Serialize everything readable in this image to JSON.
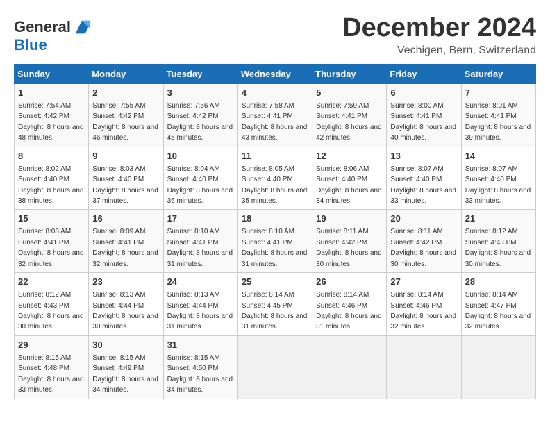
{
  "header": {
    "logo_line1": "General",
    "logo_line2": "Blue",
    "month": "December 2024",
    "location": "Vechigen, Bern, Switzerland"
  },
  "weekdays": [
    "Sunday",
    "Monday",
    "Tuesday",
    "Wednesday",
    "Thursday",
    "Friday",
    "Saturday"
  ],
  "weeks": [
    [
      {
        "day": "1",
        "info": "Sunrise: 7:54 AM\nSunset: 4:42 PM\nDaylight: 8 hours and 48 minutes."
      },
      {
        "day": "2",
        "info": "Sunrise: 7:55 AM\nSunset: 4:42 PM\nDaylight: 8 hours and 46 minutes."
      },
      {
        "day": "3",
        "info": "Sunrise: 7:56 AM\nSunset: 4:42 PM\nDaylight: 8 hours and 45 minutes."
      },
      {
        "day": "4",
        "info": "Sunrise: 7:58 AM\nSunset: 4:41 PM\nDaylight: 8 hours and 43 minutes."
      },
      {
        "day": "5",
        "info": "Sunrise: 7:59 AM\nSunset: 4:41 PM\nDaylight: 8 hours and 42 minutes."
      },
      {
        "day": "6",
        "info": "Sunrise: 8:00 AM\nSunset: 4:41 PM\nDaylight: 8 hours and 40 minutes."
      },
      {
        "day": "7",
        "info": "Sunrise: 8:01 AM\nSunset: 4:41 PM\nDaylight: 8 hours and 39 minutes."
      }
    ],
    [
      {
        "day": "8",
        "info": "Sunrise: 8:02 AM\nSunset: 4:40 PM\nDaylight: 8 hours and 38 minutes."
      },
      {
        "day": "9",
        "info": "Sunrise: 8:03 AM\nSunset: 4:40 PM\nDaylight: 8 hours and 37 minutes."
      },
      {
        "day": "10",
        "info": "Sunrise: 8:04 AM\nSunset: 4:40 PM\nDaylight: 8 hours and 36 minutes."
      },
      {
        "day": "11",
        "info": "Sunrise: 8:05 AM\nSunset: 4:40 PM\nDaylight: 8 hours and 35 minutes."
      },
      {
        "day": "12",
        "info": "Sunrise: 8:06 AM\nSunset: 4:40 PM\nDaylight: 8 hours and 34 minutes."
      },
      {
        "day": "13",
        "info": "Sunrise: 8:07 AM\nSunset: 4:40 PM\nDaylight: 8 hours and 33 minutes."
      },
      {
        "day": "14",
        "info": "Sunrise: 8:07 AM\nSunset: 4:40 PM\nDaylight: 8 hours and 33 minutes."
      }
    ],
    [
      {
        "day": "15",
        "info": "Sunrise: 8:08 AM\nSunset: 4:41 PM\nDaylight: 8 hours and 32 minutes."
      },
      {
        "day": "16",
        "info": "Sunrise: 8:09 AM\nSunset: 4:41 PM\nDaylight: 8 hours and 32 minutes."
      },
      {
        "day": "17",
        "info": "Sunrise: 8:10 AM\nSunset: 4:41 PM\nDaylight: 8 hours and 31 minutes."
      },
      {
        "day": "18",
        "info": "Sunrise: 8:10 AM\nSunset: 4:41 PM\nDaylight: 8 hours and 31 minutes."
      },
      {
        "day": "19",
        "info": "Sunrise: 8:11 AM\nSunset: 4:42 PM\nDaylight: 8 hours and 30 minutes."
      },
      {
        "day": "20",
        "info": "Sunrise: 8:11 AM\nSunset: 4:42 PM\nDaylight: 8 hours and 30 minutes."
      },
      {
        "day": "21",
        "info": "Sunrise: 8:12 AM\nSunset: 4:43 PM\nDaylight: 8 hours and 30 minutes."
      }
    ],
    [
      {
        "day": "22",
        "info": "Sunrise: 8:12 AM\nSunset: 4:43 PM\nDaylight: 8 hours and 30 minutes."
      },
      {
        "day": "23",
        "info": "Sunrise: 8:13 AM\nSunset: 4:44 PM\nDaylight: 8 hours and 30 minutes."
      },
      {
        "day": "24",
        "info": "Sunrise: 8:13 AM\nSunset: 4:44 PM\nDaylight: 8 hours and 31 minutes."
      },
      {
        "day": "25",
        "info": "Sunrise: 8:14 AM\nSunset: 4:45 PM\nDaylight: 8 hours and 31 minutes."
      },
      {
        "day": "26",
        "info": "Sunrise: 8:14 AM\nSunset: 4:46 PM\nDaylight: 8 hours and 31 minutes."
      },
      {
        "day": "27",
        "info": "Sunrise: 8:14 AM\nSunset: 4:46 PM\nDaylight: 8 hours and 32 minutes."
      },
      {
        "day": "28",
        "info": "Sunrise: 8:14 AM\nSunset: 4:47 PM\nDaylight: 8 hours and 32 minutes."
      }
    ],
    [
      {
        "day": "29",
        "info": "Sunrise: 8:15 AM\nSunset: 4:48 PM\nDaylight: 8 hours and 33 minutes."
      },
      {
        "day": "30",
        "info": "Sunrise: 8:15 AM\nSunset: 4:49 PM\nDaylight: 8 hours and 34 minutes."
      },
      {
        "day": "31",
        "info": "Sunrise: 8:15 AM\nSunset: 4:50 PM\nDaylight: 8 hours and 34 minutes."
      },
      null,
      null,
      null,
      null
    ]
  ]
}
